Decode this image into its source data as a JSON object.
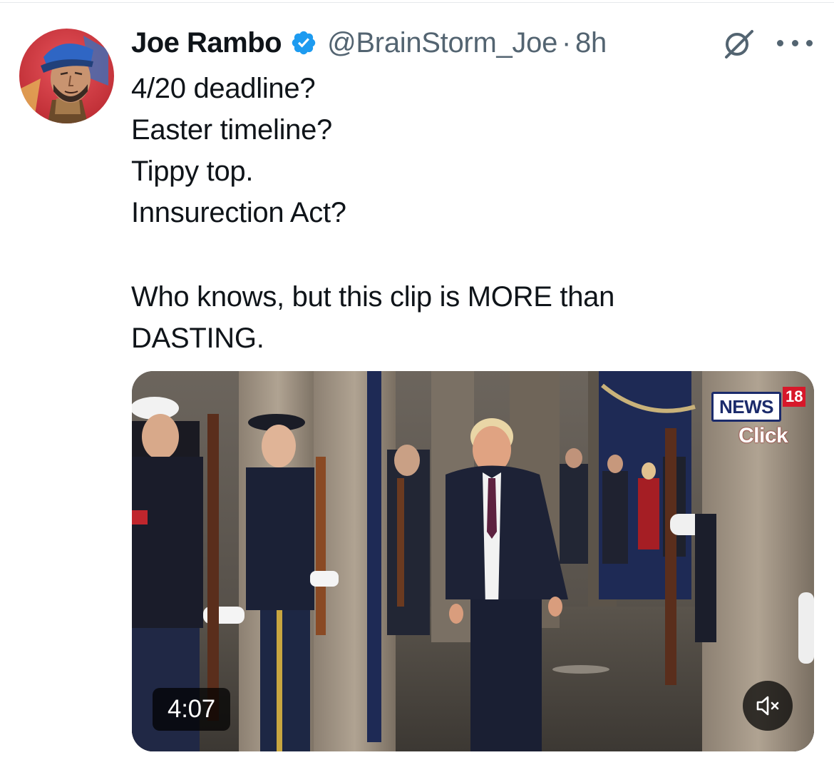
{
  "tweet": {
    "author": {
      "display_name": "Joe Rambo",
      "handle": "@BrainStorm_Joe",
      "separator": "·",
      "time_ago": "8h",
      "verified": true,
      "verified_color": "#1d9bf0"
    },
    "text_lines": [
      "4/20 deadline?",
      "Easter timeline?",
      "Tippy top.",
      "Innsurection Act?",
      "",
      "Who knows, but this clip is MORE than",
      "DASTING."
    ],
    "media": {
      "type": "video",
      "duration": "4:07",
      "muted": true,
      "channel_logo": {
        "word": "NEWS",
        "number": "18",
        "sub": "Click"
      }
    }
  },
  "icons": {
    "grok": "grok-icon",
    "more": "more-options-icon",
    "verified": "verified-badge-icon",
    "mute": "speaker-muted-icon"
  },
  "colors": {
    "text_primary": "#0f1419",
    "text_secondary": "#536471",
    "accent": "#1d9bf0"
  }
}
